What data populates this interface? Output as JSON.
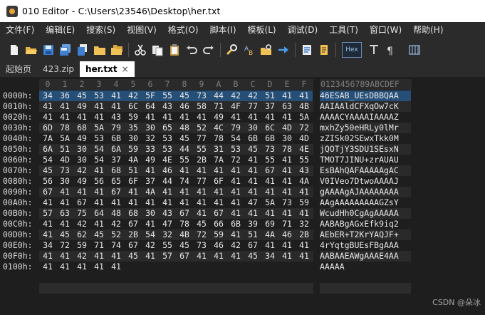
{
  "window": {
    "title": "010 Editor - C:\\Users\\23546\\Desktop\\her.txt",
    "app_icon": "app-icon"
  },
  "menu": [
    "文件(F)",
    "编辑(E)",
    "搜索(S)",
    "视图(V)",
    "格式(O)",
    "脚本(I)",
    "模板(L)",
    "调试(D)",
    "工具(T)",
    "窗口(W)",
    "帮助(H)"
  ],
  "toolbar": {
    "hex_label": "Hex",
    "icons": [
      "new-file-icon",
      "open-folder-icon",
      "save-icon",
      "save-all-icon",
      "copy-icon",
      "folder-icon",
      "multi-folder-icon",
      "cut-icon",
      "paste-icon",
      "clipboard-icon",
      "undo-icon",
      "redo-icon",
      "find-icon",
      "replace-icon",
      "find-in-files-icon",
      "goto-icon",
      "template-icon",
      "script-icon",
      "paragraph-icon",
      "columns-icon"
    ]
  },
  "tabs": [
    {
      "label": "起始页",
      "active": false
    },
    {
      "label": "423.zip",
      "active": false
    },
    {
      "label": "her.txt",
      "active": true,
      "close": "×"
    }
  ],
  "editor": {
    "column_headers": [
      "0",
      "1",
      "2",
      "3",
      "4",
      "5",
      "6",
      "7",
      "8",
      "9",
      "A",
      "B",
      "C",
      "D",
      "E",
      "F"
    ],
    "ascii_header": "0123456789ABCDEF",
    "rows": [
      {
        "addr": "0000h:",
        "hex": [
          "34",
          "36",
          "45",
          "53",
          "41",
          "42",
          "5F",
          "55",
          "45",
          "73",
          "44",
          "42",
          "42",
          "51",
          "41",
          "41"
        ],
        "ascii": "46ESAB_UEsDBBQAA"
      },
      {
        "addr": "0010h:",
        "hex": [
          "41",
          "41",
          "49",
          "41",
          "41",
          "6C",
          "64",
          "43",
          "46",
          "58",
          "71",
          "4F",
          "77",
          "37",
          "63",
          "4B"
        ],
        "ascii": "AAIAAldCFXqOw7cK"
      },
      {
        "addr": "0020h:",
        "hex": [
          "41",
          "41",
          "41",
          "41",
          "43",
          "59",
          "41",
          "41",
          "41",
          "41",
          "49",
          "41",
          "41",
          "41",
          "41",
          "5A"
        ],
        "ascii": "AAAACYAAAAIAAAAZ"
      },
      {
        "addr": "0030h:",
        "hex": [
          "6D",
          "78",
          "68",
          "5A",
          "79",
          "35",
          "30",
          "65",
          "48",
          "52",
          "4C",
          "79",
          "30",
          "6C",
          "4D",
          "72"
        ],
        "ascii": "mxhZy50eHRLy0lMr"
      },
      {
        "addr": "0040h:",
        "hex": [
          "7A",
          "5A",
          "49",
          "53",
          "6B",
          "30",
          "32",
          "53",
          "45",
          "77",
          "78",
          "54",
          "6B",
          "6B",
          "30",
          "4D"
        ],
        "ascii": "zZISk02SEwxTkk0M"
      },
      {
        "addr": "0050h:",
        "hex": [
          "6A",
          "51",
          "30",
          "54",
          "6A",
          "59",
          "33",
          "53",
          "44",
          "55",
          "31",
          "53",
          "45",
          "73",
          "78",
          "4E"
        ],
        "ascii": "jQOTjY3SDU1SEsxN"
      },
      {
        "addr": "0060h:",
        "hex": [
          "54",
          "4D",
          "30",
          "54",
          "37",
          "4A",
          "49",
          "4E",
          "55",
          "2B",
          "7A",
          "72",
          "41",
          "55",
          "41",
          "55"
        ],
        "ascii": "TMOT7JINU+zrAUAU"
      },
      {
        "addr": "0070h:",
        "hex": [
          "45",
          "73",
          "42",
          "41",
          "68",
          "51",
          "41",
          "46",
          "41",
          "41",
          "41",
          "41",
          "41",
          "67",
          "41",
          "43"
        ],
        "ascii": "EsBAhQAFAAAAAgAC"
      },
      {
        "addr": "0080h:",
        "hex": [
          "56",
          "30",
          "49",
          "56",
          "65",
          "6F",
          "37",
          "44",
          "74",
          "77",
          "6F",
          "41",
          "41",
          "41",
          "41",
          "4A"
        ],
        "ascii": "V0IVeo7DtwoAAAAJ"
      },
      {
        "addr": "0090h:",
        "hex": [
          "67",
          "41",
          "41",
          "41",
          "67",
          "41",
          "4A",
          "41",
          "41",
          "41",
          "41",
          "41",
          "41",
          "41",
          "41",
          "41"
        ],
        "ascii": "gAAAAgAJAAAAAAAA"
      },
      {
        "addr": "00A0h:",
        "hex": [
          "41",
          "41",
          "67",
          "41",
          "41",
          "41",
          "41",
          "41",
          "41",
          "41",
          "41",
          "41",
          "47",
          "5A",
          "73",
          "59"
        ],
        "ascii": "AAgAAAAAAAAAGZsY"
      },
      {
        "addr": "00B0h:",
        "hex": [
          "57",
          "63",
          "75",
          "64",
          "48",
          "68",
          "30",
          "43",
          "67",
          "41",
          "67",
          "41",
          "41",
          "41",
          "41",
          "41"
        ],
        "ascii": "WcudHh0CgAgAAAAA"
      },
      {
        "addr": "00C0h:",
        "hex": [
          "41",
          "41",
          "42",
          "41",
          "42",
          "67",
          "41",
          "47",
          "78",
          "45",
          "66",
          "6B",
          "39",
          "69",
          "71",
          "32"
        ],
        "ascii": "AABABgAGxEfk9iq2"
      },
      {
        "addr": "00D0h:",
        "hex": [
          "41",
          "45",
          "62",
          "45",
          "52",
          "2B",
          "54",
          "32",
          "4B",
          "72",
          "59",
          "41",
          "51",
          "4A",
          "46",
          "2B"
        ],
        "ascii": "AEbER+T2KrYAQJF+"
      },
      {
        "addr": "00E0h:",
        "hex": [
          "34",
          "72",
          "59",
          "71",
          "74",
          "67",
          "42",
          "55",
          "45",
          "73",
          "46",
          "42",
          "67",
          "41",
          "41",
          "41"
        ],
        "ascii": "4rYqtgBUEsFBgAAA"
      },
      {
        "addr": "00F0h:",
        "hex": [
          "41",
          "41",
          "42",
          "41",
          "41",
          "45",
          "41",
          "57",
          "67",
          "41",
          "41",
          "41",
          "45",
          "34",
          "41",
          "41"
        ],
        "ascii": "AABAAEAWgAAAE4AA"
      },
      {
        "addr": "0100h:",
        "hex": [
          "41",
          "41",
          "41",
          "41",
          "41"
        ],
        "ascii": "AAAAA"
      }
    ]
  },
  "watermark": "CSDN @朵冰"
}
